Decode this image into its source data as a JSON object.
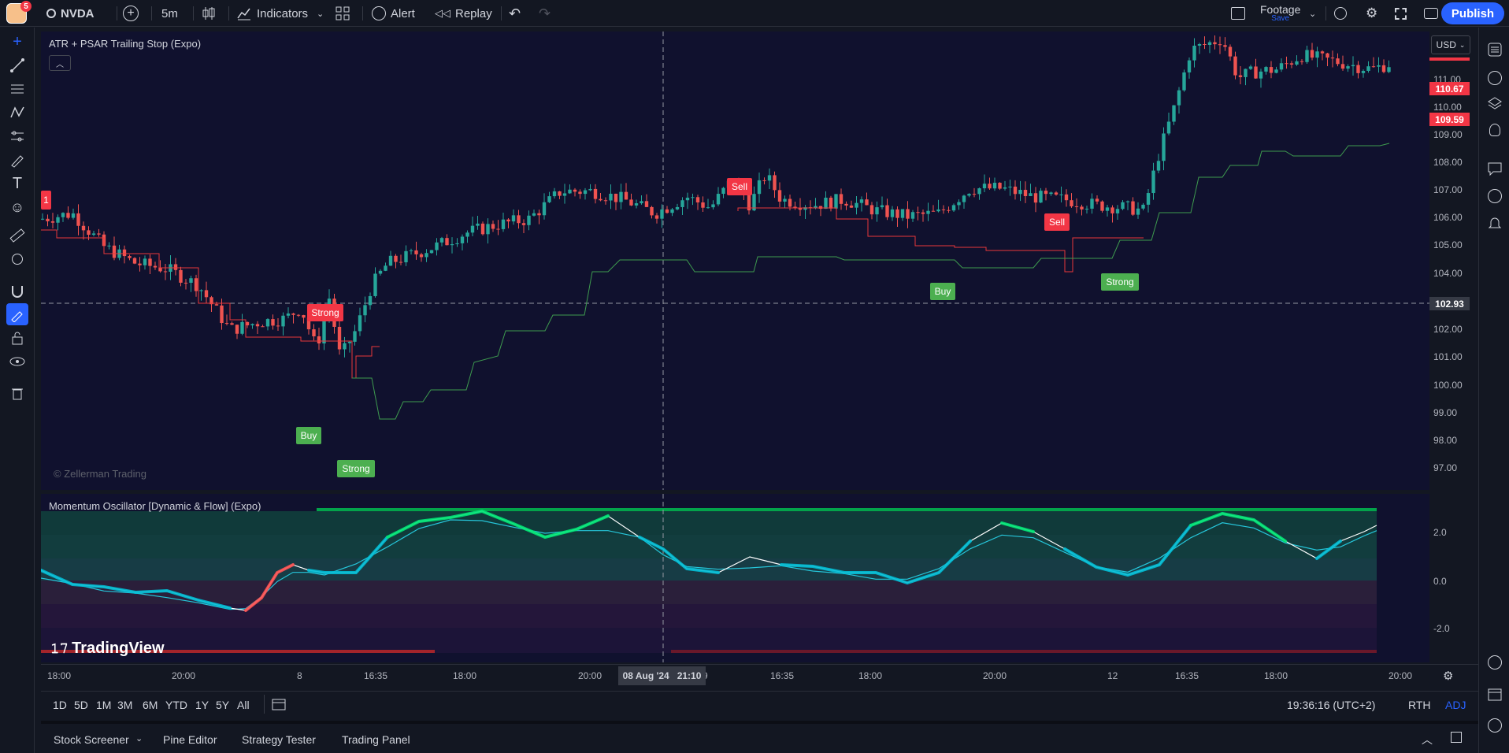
{
  "topbar": {
    "badge_count": "5",
    "symbol": "NVDA",
    "interval": "5m",
    "indicators_label": "Indicators",
    "alert_label": "Alert",
    "replay_label": "Replay",
    "layout_name": "Footage",
    "layout_save": "Save",
    "publish_label": "Publish"
  },
  "main_pane": {
    "indicator_title": "ATR + PSAR Trailing Stop (Expo)",
    "watermark": "© Zellerman Trading",
    "currency": "USD",
    "signals": [
      "Strong",
      "Buy",
      "Strong",
      "Sell",
      "Buy",
      "Sell",
      "Strong",
      "1"
    ]
  },
  "osc_pane": {
    "indicator_title": "Momentum Oscillator [Dynamic & Flow] (Expo)",
    "logo_text": "TradingView",
    "levels": [
      "2.0",
      "0.0",
      "-2.0"
    ]
  },
  "price_scale": {
    "labels": [
      "111.00",
      "110.00",
      "109.00",
      "108.00",
      "107.00",
      "106.00",
      "105.00",
      "104.00",
      "102.00",
      "101.00",
      "100.00",
      "99.00",
      "98.00",
      "97.00"
    ],
    "tag_high": "110.67",
    "tag_last": "109.59",
    "crosshair_price": "102.93"
  },
  "time_axis": {
    "labels": [
      "18:00",
      "20:00",
      "8",
      "16:35",
      "18:00",
      "20:00",
      "9",
      "16:35",
      "18:00",
      "20:00",
      "12",
      "16:35",
      "18:00",
      "20:00"
    ],
    "crosshair_time": "08 Aug '24   21:10"
  },
  "range_bar": {
    "ranges": [
      "1D",
      "5D",
      "1M",
      "3M",
      "6M",
      "YTD",
      "1Y",
      "5Y",
      "All"
    ],
    "clock": "19:36:16 (UTC+2)",
    "session": "RTH",
    "adj": "ADJ"
  },
  "bottom_bar": {
    "tabs": [
      "Stock Screener",
      "Pine Editor",
      "Strategy Tester",
      "Trading Panel"
    ]
  },
  "colors": {
    "accent": "#2962ff",
    "up": "#26a69a",
    "down": "#ef5350",
    "sell_tag": "#f23645",
    "buy_tag": "#4caf50",
    "osc_green": "#00e676",
    "osc_cyan": "#00bcd4",
    "osc_red": "#ff5252",
    "pane_bg": "#10112e"
  }
}
